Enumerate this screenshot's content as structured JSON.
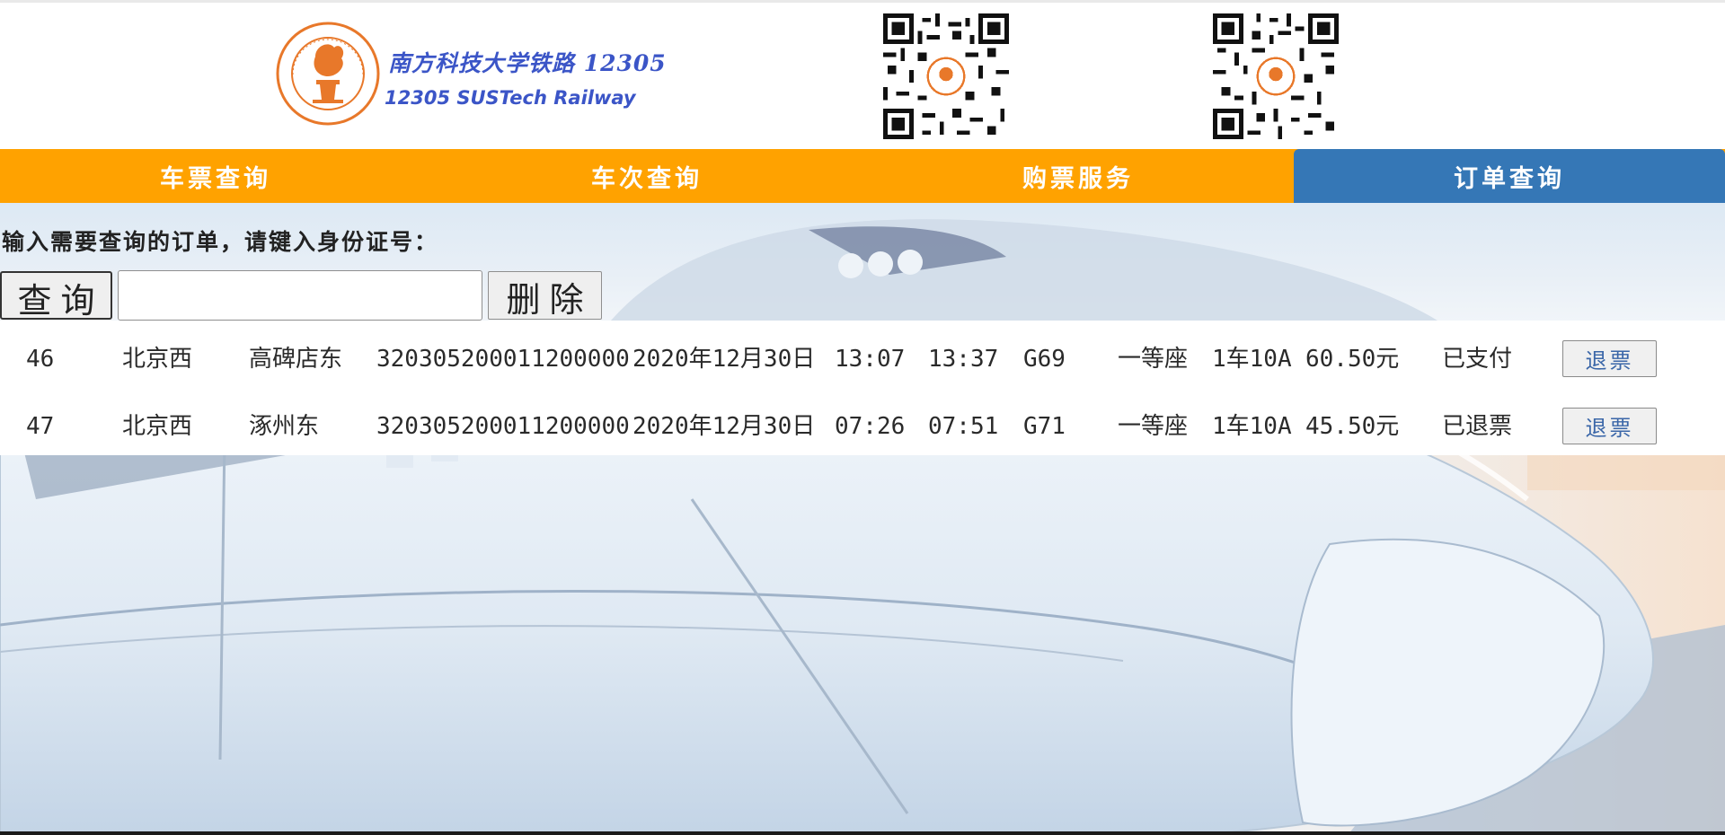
{
  "header": {
    "logo_cn": "南方科技大学铁路 12305",
    "logo_en": "12305 SUSTech Railway"
  },
  "nav": {
    "items": [
      {
        "label": "车票查询"
      },
      {
        "label": "车次查询"
      },
      {
        "label": "购票服务"
      },
      {
        "label": "订单查询"
      }
    ],
    "active_index": 3
  },
  "query": {
    "prompt": "输入需要查询的订单，请键入身份证号：",
    "search_label": "查询",
    "delete_label": "删除",
    "input_value": ""
  },
  "orders": [
    {
      "id": "46",
      "from": "北京西",
      "to": "高碑店东",
      "id_number": "320305200011200000",
      "date": "2020年12月30日",
      "depart": "13:07",
      "arrive": "13:37",
      "train": "G69",
      "seat_class": "一等座",
      "seat": "1车10A",
      "price": "60.50元",
      "status": "已支付",
      "action_label": "退票"
    },
    {
      "id": "47",
      "from": "北京西",
      "to": "涿州东",
      "id_number": "320305200011200000",
      "date": "2020年12月30日",
      "depart": "07:26",
      "arrive": "07:51",
      "train": "G71",
      "seat_class": "一等座",
      "seat": "1车10A",
      "price": "45.50元",
      "status": "已退票",
      "action_label": "退票"
    }
  ],
  "colors": {
    "nav_bg": "#ffa200",
    "nav_active": "#3577b6",
    "logo_text": "#3b55c7",
    "seal": "#e8782a"
  }
}
